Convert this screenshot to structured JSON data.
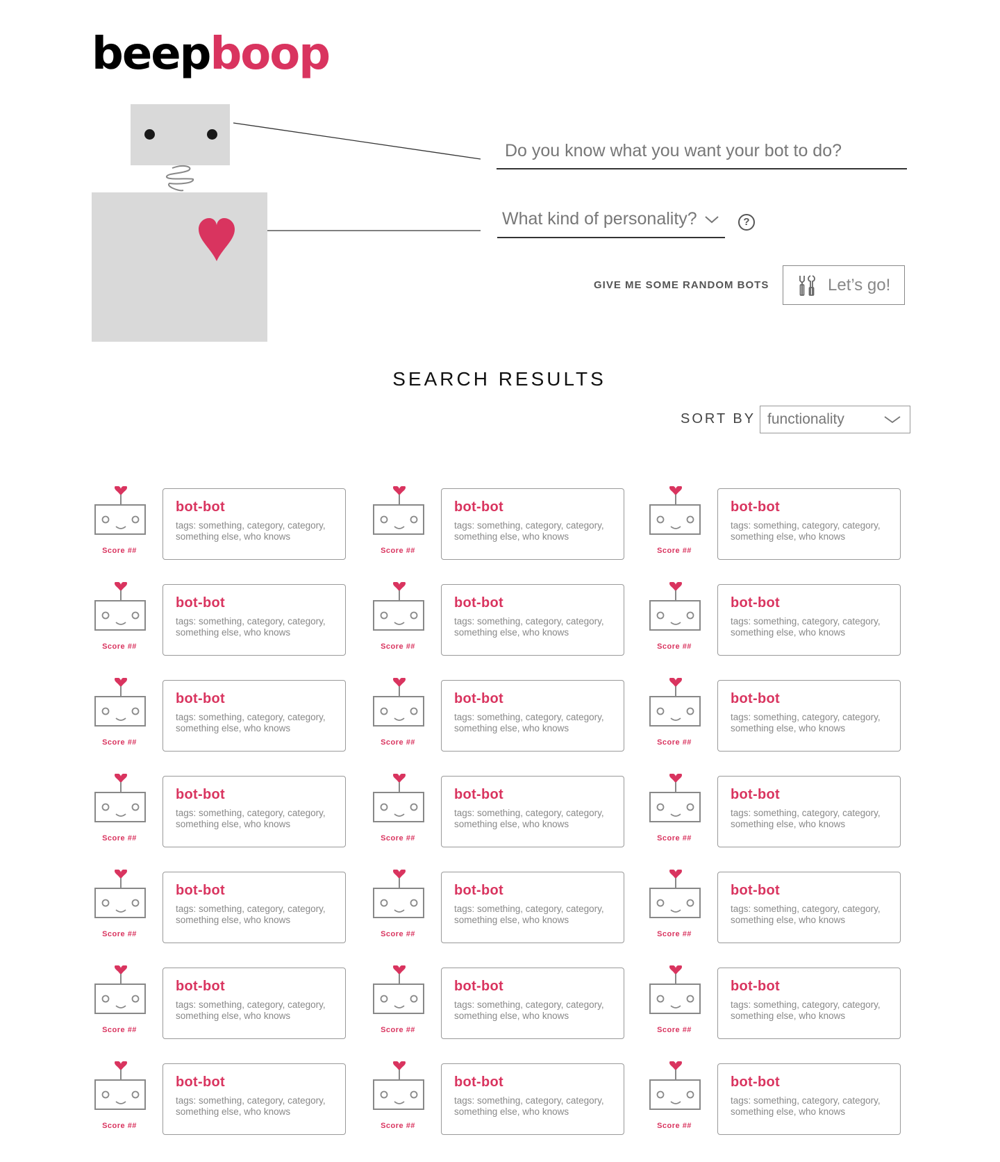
{
  "brand": {
    "part1": "beep",
    "part2": "boop"
  },
  "question": {
    "placeholder": "Do you know what you want your bot to do?"
  },
  "personality": {
    "label": "What kind of personality?"
  },
  "help": {
    "label": "?"
  },
  "actions": {
    "random_label": "GIVE ME SOME RANDOM BOTS",
    "go_label": "Let’s go!"
  },
  "results": {
    "title": "SEARCH RESULTS",
    "sort_label": "SORT BY",
    "sort_value": "functionality",
    "items": [
      {
        "name": "bot-bot",
        "tags": "tags: something, category, category, something else, who knows",
        "score": "Score ##"
      },
      {
        "name": "bot-bot",
        "tags": "tags: something, category, category, something else, who knows",
        "score": "Score ##"
      },
      {
        "name": "bot-bot",
        "tags": "tags: something, category, category, something else, who knows",
        "score": "Score ##"
      },
      {
        "name": "bot-bot",
        "tags": "tags: something, category, category, something else, who knows",
        "score": "Score ##"
      },
      {
        "name": "bot-bot",
        "tags": "tags: something, category, category, something else, who knows",
        "score": "Score ##"
      },
      {
        "name": "bot-bot",
        "tags": "tags: something, category, category, something else, who knows",
        "score": "Score ##"
      },
      {
        "name": "bot-bot",
        "tags": "tags: something, category, category, something else, who knows",
        "score": "Score ##"
      },
      {
        "name": "bot-bot",
        "tags": "tags: something, category, category, something else, who knows",
        "score": "Score ##"
      },
      {
        "name": "bot-bot",
        "tags": "tags: something, category, category, something else, who knows",
        "score": "Score ##"
      },
      {
        "name": "bot-bot",
        "tags": "tags: something, category, category, something else, who knows",
        "score": "Score ##"
      },
      {
        "name": "bot-bot",
        "tags": "tags: something, category, category, something else, who knows",
        "score": "Score ##"
      },
      {
        "name": "bot-bot",
        "tags": "tags: something, category, category, something else, who knows",
        "score": "Score ##"
      },
      {
        "name": "bot-bot",
        "tags": "tags: something, category, category, something else, who knows",
        "score": "Score ##"
      },
      {
        "name": "bot-bot",
        "tags": "tags: something, category, category, something else, who knows",
        "score": "Score ##"
      },
      {
        "name": "bot-bot",
        "tags": "tags: something, category, category, something else, who knows",
        "score": "Score ##"
      },
      {
        "name": "bot-bot",
        "tags": "tags: something, category, category, something else, who knows",
        "score": "Score ##"
      },
      {
        "name": "bot-bot",
        "tags": "tags: something, category, category, something else, who knows",
        "score": "Score ##"
      },
      {
        "name": "bot-bot",
        "tags": "tags: something, category, category, something else, who knows",
        "score": "Score ##"
      },
      {
        "name": "bot-bot",
        "tags": "tags: something, category, category, something else, who knows",
        "score": "Score ##"
      },
      {
        "name": "bot-bot",
        "tags": "tags: something, category, category, something else, who knows",
        "score": "Score ##"
      },
      {
        "name": "bot-bot",
        "tags": "tags: something, category, category, something else, who knows",
        "score": "Score ##"
      }
    ]
  },
  "colors": {
    "accent": "#d9345f",
    "robot_gray": "#d9d9d9"
  },
  "icons": {
    "tools": "tools-icon",
    "chevron": "chevron-down-icon",
    "heart": "heart-icon",
    "help": "question-icon"
  }
}
